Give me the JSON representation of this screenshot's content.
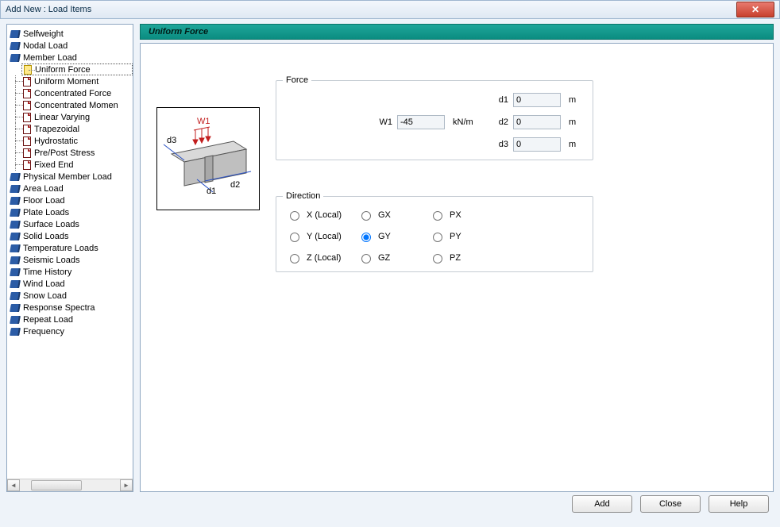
{
  "window": {
    "title": "Add New : Load Items"
  },
  "tree": {
    "top": [
      {
        "label": "Selfweight"
      },
      {
        "label": "Nodal Load"
      },
      {
        "label": "Member Load",
        "expanded": true,
        "children": [
          {
            "label": "Uniform Force",
            "selected": true
          },
          {
            "label": "Uniform Moment"
          },
          {
            "label": "Concentrated Force"
          },
          {
            "label": "Concentrated Momen"
          },
          {
            "label": "Linear Varying"
          },
          {
            "label": "Trapezoidal"
          },
          {
            "label": "Hydrostatic"
          },
          {
            "label": "Pre/Post Stress"
          },
          {
            "label": "Fixed End"
          }
        ]
      },
      {
        "label": "Physical Member Load"
      },
      {
        "label": "Area Load"
      },
      {
        "label": "Floor Load"
      },
      {
        "label": "Plate Loads"
      },
      {
        "label": "Surface Loads"
      },
      {
        "label": "Solid Loads"
      },
      {
        "label": "Temperature Loads"
      },
      {
        "label": "Seismic Loads"
      },
      {
        "label": "Time History"
      },
      {
        "label": "Wind Load"
      },
      {
        "label": "Snow Load"
      },
      {
        "label": "Response Spectra"
      },
      {
        "label": "Repeat Load"
      },
      {
        "label": "Frequency"
      }
    ]
  },
  "panel": {
    "title": "Uniform Force"
  },
  "force": {
    "legend": "Force",
    "w1_label": "W1",
    "w1_value": "-45",
    "w1_unit": "kN/m",
    "d1_label": "d1",
    "d1_value": "0",
    "d1_unit": "m",
    "d2_label": "d2",
    "d2_value": "0",
    "d2_unit": "m",
    "d3_label": "d3",
    "d3_value": "0",
    "d3_unit": "m"
  },
  "direction": {
    "legend": "Direction",
    "options": [
      {
        "label": "X (Local)"
      },
      {
        "label": "GX"
      },
      {
        "label": "PX"
      },
      {
        "label": "Y (Local)"
      },
      {
        "label": "GY"
      },
      {
        "label": "PY"
      },
      {
        "label": "Z (Local)"
      },
      {
        "label": "GZ"
      },
      {
        "label": "PZ"
      }
    ],
    "selected": "GY"
  },
  "diagram_labels": {
    "w1": "W1",
    "d1": "d1",
    "d2": "d2",
    "d3": "d3"
  },
  "buttons": {
    "add": "Add",
    "close": "Close",
    "help": "Help"
  }
}
